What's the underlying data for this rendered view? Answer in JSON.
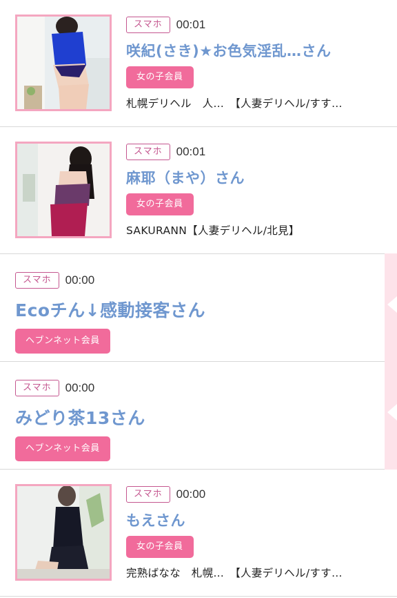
{
  "items": [
    {
      "type": "thumb",
      "device": "スマホ",
      "time": "00:01",
      "name": "咲紀(さき)★お色気淫乱…さん",
      "member": "女の子会員",
      "shop": "札幌デリヘル　人…　【人妻デリヘル/すす…"
    },
    {
      "type": "thumb",
      "device": "スマホ",
      "time": "00:01",
      "name": "麻耶（まや）さん",
      "member": "女の子会員",
      "shop": "SAKURANN【人妻デリヘル/北見】"
    },
    {
      "type": "text",
      "device": "スマホ",
      "time": "00:00",
      "name": "Ecoチん↓感動接客さん",
      "member": "ヘブンネット会員"
    },
    {
      "type": "text",
      "device": "スマホ",
      "time": "00:00",
      "name": "みどり茶13さん",
      "member": "ヘブンネット会員"
    },
    {
      "type": "thumb",
      "device": "スマホ",
      "time": "00:00",
      "name": "もえさん",
      "member": "女の子会員",
      "shop": "完熟ばなな　札幌…　【人妻デリヘル/すす…"
    }
  ],
  "colors": {
    "device_badge": "#c4568f",
    "name": "#6f97cf",
    "member_badge": "#f16b9b",
    "thumb_border": "#f4a6c0",
    "side_band": "#fde3ea"
  }
}
